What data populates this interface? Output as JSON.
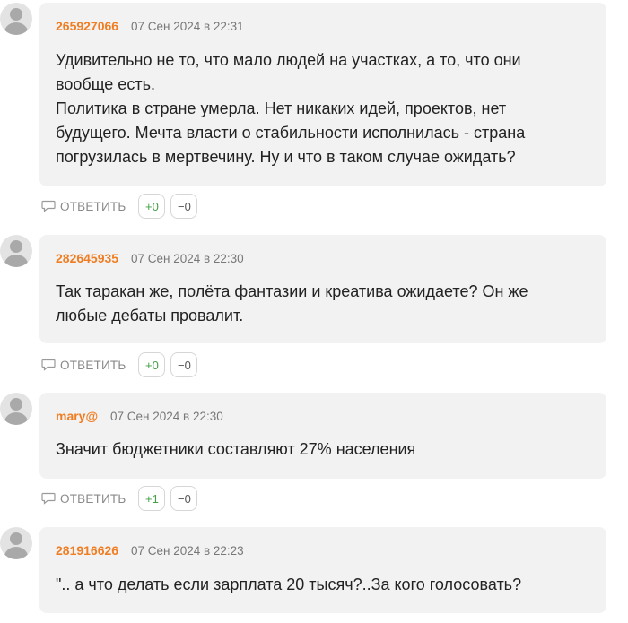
{
  "comments": [
    {
      "author": "265927066",
      "date": "07 Сен 2024 в 22:31",
      "lines": [
        "Удивительно не то, что мало людей на участках, а то, что они",
        "вообще есть.",
        "Политика в стране умерла. Нет никаких идей, проектов, нет",
        "будущего. Мечта власти о стабильности исполнилась - страна",
        "погрузилась в мертвечину. Ну и что в таком случае ожидать?"
      ],
      "reply_label": "ОТВЕТИТЬ",
      "plus": "+0",
      "minus": "−0"
    },
    {
      "author": "282645935",
      "date": "07 Сен 2024 в 22:30",
      "lines": [
        "Так таракан же, полёта фантазии и креатива ожидаете? Он же",
        "любые дебаты провалит."
      ],
      "reply_label": "ОТВЕТИТЬ",
      "plus": "+0",
      "minus": "−0"
    },
    {
      "author": "mary@",
      "date": "07 Сен 2024 в 22:30",
      "lines": [
        "Значит бюджетники составляют 27% населения"
      ],
      "reply_label": "ОТВЕТИТЬ",
      "plus": "+1",
      "minus": "−0"
    },
    {
      "author": "281916626",
      "date": "07 Сен 2024 в 22:23",
      "lines": [
        "\".. а что делать если зарплата 20 тысяч?..За кого голосовать?"
      ]
    }
  ],
  "colors": {
    "author": "#f07d22",
    "bubble": "#f2f2f2",
    "plus_vote": "#43a047"
  },
  "icons": {
    "avatar": "user-silhouette-icon",
    "reply": "speech-bubble-icon"
  }
}
